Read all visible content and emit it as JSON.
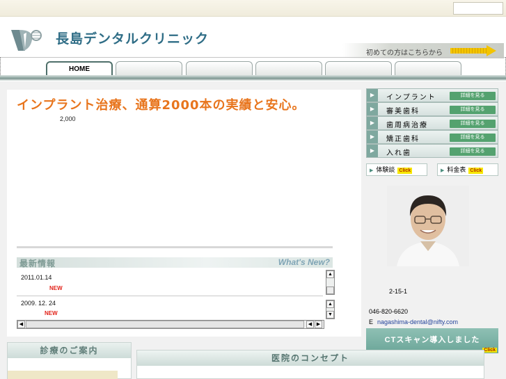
{
  "header": {
    "clinic_name": "長島デンタルクリニック",
    "first_time_link": "初めての方はこちらから"
  },
  "nav": {
    "tabs": [
      {
        "label": "HOME",
        "active": true
      },
      {
        "label": ""
      },
      {
        "label": ""
      },
      {
        "label": ""
      },
      {
        "label": ""
      },
      {
        "label": ""
      }
    ]
  },
  "main": {
    "headline": "インプラント治療、通算2000本の実績と安心。",
    "implant_count": "2,000"
  },
  "news": {
    "title": "最新情報",
    "title_en": "What's New?",
    "items": [
      {
        "date": "2011.01.14",
        "badge": "NEW"
      },
      {
        "date": "2009. 12. 24",
        "badge": "NEW"
      }
    ]
  },
  "sidebar": {
    "menu": [
      {
        "label": "インプラント",
        "detail": "詳細を見る"
      },
      {
        "label": "審美歯科",
        "detail": "詳細を見る"
      },
      {
        "label": "歯周病治療",
        "detail": "詳細を見る"
      },
      {
        "label": "矯正歯科",
        "detail": "詳細を見る"
      },
      {
        "label": "入れ歯",
        "detail": "詳細を見る"
      }
    ],
    "experience": {
      "label": "体験談",
      "click": "Click"
    },
    "fees": {
      "label": "料金表",
      "click": "Click"
    },
    "address": "2-15-1",
    "tel": "046-820-6620",
    "email_prefix": "E",
    "email": "nagashima-dental@nifty.com",
    "ct_banner": "CTスキャン導入しました",
    "ct_click": "Click"
  },
  "bottom": {
    "guide_title": "診療のご案内",
    "concept_title": "医院のコンセプト"
  },
  "colors": {
    "accent_orange": "#e8751d",
    "brand_teal": "#2f6d86",
    "detail_green": "#54a26f",
    "new_red": "#e2231a"
  }
}
